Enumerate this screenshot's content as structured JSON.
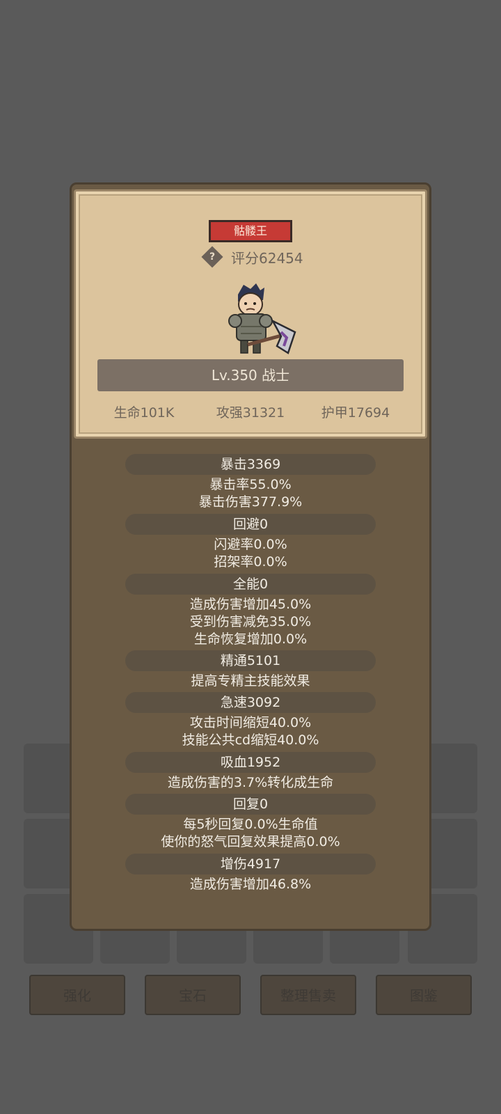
{
  "background": {
    "buttons": [
      "强化",
      "宝石",
      "整理售卖",
      "图鉴"
    ]
  },
  "hero": {
    "name_tag": "骷髅王",
    "score": "评分62454",
    "help_icon": "?",
    "level_class": "Lv.350 战士",
    "stats": [
      "生命101K",
      "攻强31321",
      "护甲17694"
    ]
  },
  "details": [
    {
      "title": "暴击3369",
      "lines": [
        "暴击率55.0%",
        "暴击伤害377.9%"
      ]
    },
    {
      "title": "回避0",
      "lines": [
        "闪避率0.0%",
        "招架率0.0%"
      ]
    },
    {
      "title": "全能0",
      "lines": [
        "造成伤害增加45.0%",
        "受到伤害减免35.0%",
        "生命恢复增加0.0%"
      ]
    },
    {
      "title": "精通5101",
      "lines": [
        "提高专精主技能效果"
      ]
    },
    {
      "title": "急速3092",
      "lines": [
        "攻击时间缩短40.0%",
        "技能公共cd缩短40.0%"
      ]
    },
    {
      "title": "吸血1952",
      "lines": [
        "造成伤害的3.7%转化成生命"
      ]
    },
    {
      "title": "回复0",
      "lines": [
        "每5秒回复0.0%生命值",
        "使你的怒气回复效果提高0.0%"
      ]
    },
    {
      "title": "增伤4917",
      "lines": [
        "造成伤害增加46.8%"
      ]
    }
  ],
  "colors": {
    "name_tag_bg": "#c63a35",
    "card_bg": "#dcc49d",
    "panel_bg": "#6a5a44"
  }
}
